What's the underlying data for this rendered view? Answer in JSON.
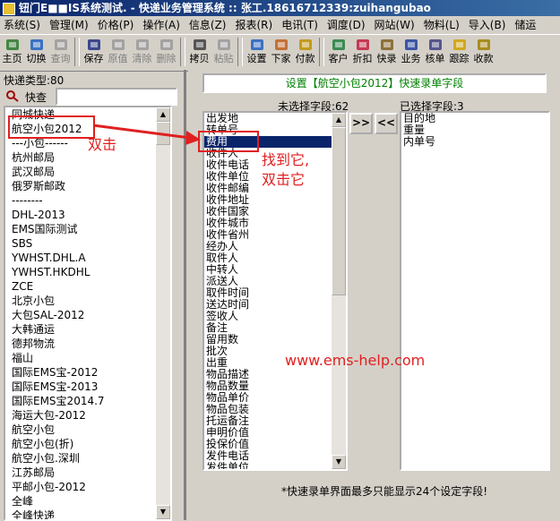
{
  "window": {
    "title": "钮门E■■IS系统测试. - 快递业务管理系统 :: 张工.18616712339:zuihangubao"
  },
  "menu": [
    "系统(S)",
    "管理(M)",
    "价格(P)",
    "操作(A)",
    "信息(Z)",
    "报表(R)",
    "电讯(T)",
    "调度(D)",
    "网站(W)",
    "物料(L)",
    "导入(B)",
    "储运"
  ],
  "toolbar": [
    {
      "label": "主页",
      "icon": "home-icon",
      "enabled": true
    },
    {
      "label": "切换",
      "icon": "switch-icon",
      "enabled": true
    },
    {
      "label": "查询",
      "icon": "query-icon",
      "enabled": false
    },
    {
      "sep": true
    },
    {
      "label": "保存",
      "icon": "save-icon",
      "enabled": true
    },
    {
      "label": "原值",
      "icon": "revert-icon",
      "enabled": false
    },
    {
      "label": "清除",
      "icon": "clear-icon",
      "enabled": false
    },
    {
      "label": "删除",
      "icon": "delete-icon",
      "enabled": false
    },
    {
      "sep": true
    },
    {
      "label": "拷贝",
      "icon": "copy-icon",
      "enabled": true
    },
    {
      "label": "粘贴",
      "icon": "paste-icon",
      "enabled": false
    },
    {
      "sep": true
    },
    {
      "label": "设置",
      "icon": "settings-icon",
      "enabled": true
    },
    {
      "label": "下家",
      "icon": "next-party-icon",
      "enabled": true
    },
    {
      "label": "付款",
      "icon": "payment-icon",
      "enabled": true
    },
    {
      "sep": true
    },
    {
      "label": "客户",
      "icon": "customer-icon",
      "enabled": true
    },
    {
      "label": "折扣",
      "icon": "discount-icon",
      "enabled": true
    },
    {
      "label": "快录",
      "icon": "quick-entry-icon",
      "enabled": true
    },
    {
      "label": "业务",
      "icon": "business-icon",
      "enabled": true
    },
    {
      "label": "核单",
      "icon": "verify-icon",
      "enabled": true
    },
    {
      "label": "跟踪",
      "icon": "track-icon",
      "enabled": true
    },
    {
      "label": "收款",
      "icon": "collect-icon",
      "enabled": true
    }
  ],
  "left": {
    "type_label": "快递类型:80",
    "search_label": "快查",
    "search_value": "",
    "items": [
      "同城快递",
      "航空小包2012",
      "---小包------",
      "杭州邮局",
      "武汉邮局",
      "俄罗斯邮政",
      "--------",
      "DHL-2013",
      "EMS国际测试",
      "SBS",
      "YWHST.DHL.A",
      "YWHST.HKDHL",
      "ZCE",
      "北京小包",
      "大包SAL-2012",
      "大韩通运",
      "德邦物流",
      "福山",
      "国际EMS宝-2012",
      "国际EMS宝-2013",
      "国际EMS宝2014.7",
      "海运大包-2012",
      "航空小包",
      "航空小包(折)",
      "航空小包.深圳",
      "江苏邮局",
      "平邮小包-2012",
      "全峰",
      "全峰快递"
    ]
  },
  "right": {
    "title": "设置【航空小包2012】快速录单字段",
    "unselected_label": "未选择字段:62",
    "selected_label": "已选择字段:3",
    "add_button": ">>",
    "remove_button": "<<",
    "unselected_items": [
      "出发地",
      "转单号",
      "费用",
      "收件人",
      "收件电话",
      "收件单位",
      "收件邮编",
      "收件地址",
      "收件国家",
      "收件城市",
      "收件省州",
      "经办人",
      "取件人",
      "中转人",
      "派送人",
      "取件时间",
      "送达时间",
      "签收人",
      "备注",
      "留用数",
      "批次",
      "出重",
      "物品描述",
      "物品数量",
      "物品单价",
      "物品包装",
      "托运备注",
      "申明价值",
      "投保价值",
      "发件电话",
      "发件单位"
    ],
    "selected_items": [
      "目的地",
      "重量",
      "内单号"
    ],
    "note": "*快速录单界面最多只能显示24个设定字段!"
  },
  "annotations": {
    "dblclick_text": "双击",
    "find_text_1": "找到它,",
    "find_text_2": "双击它",
    "watermark": "www.ems-help.com"
  },
  "colors": {
    "title_bg": "#0a246a",
    "annotation": "#e02020",
    "selection": "#0a246a",
    "title_text": "#008000"
  }
}
